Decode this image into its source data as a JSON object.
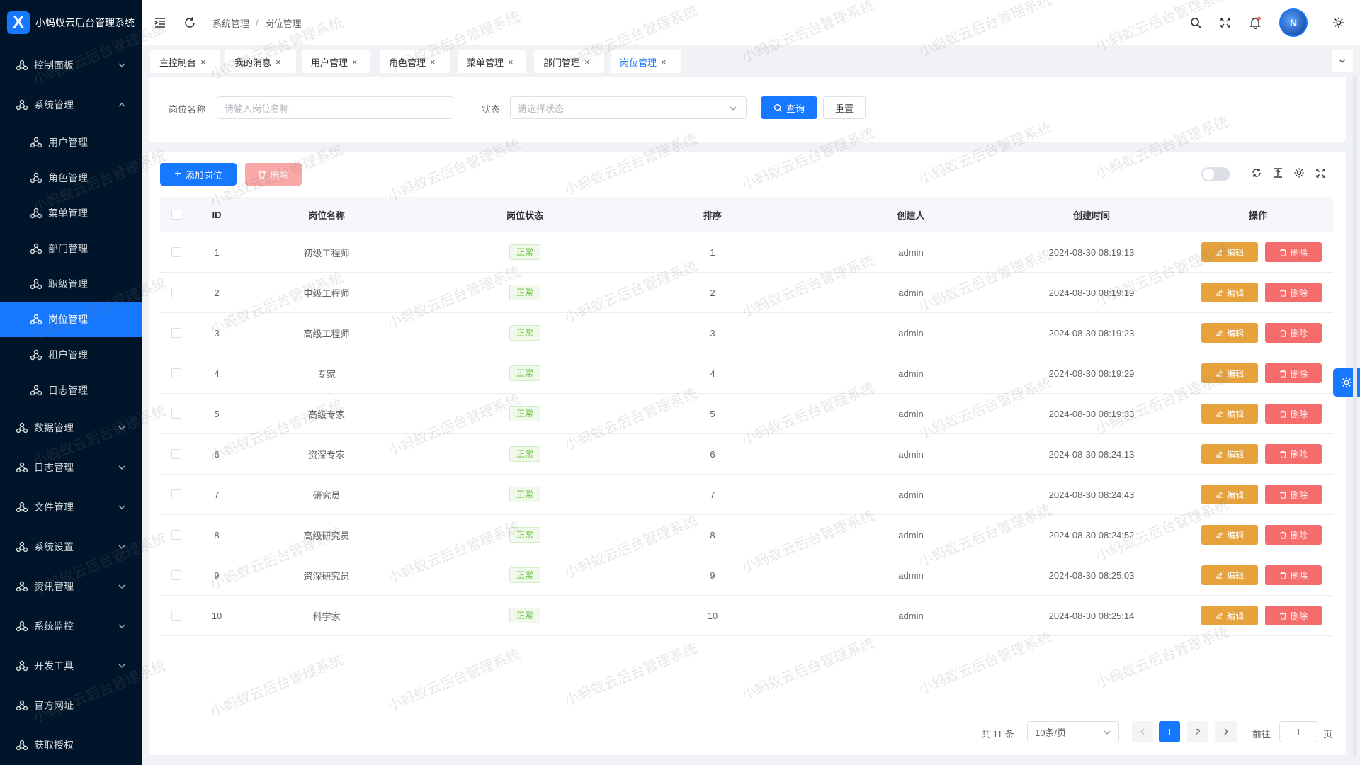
{
  "app": {
    "title": "小蚂蚁云后台管理系统",
    "logo_letter": "X",
    "watermark": "小蚂蚁云后台管理系统"
  },
  "colors": {
    "primary": "#1677ff",
    "sidebar_bg": "#001529",
    "warning": "#e6a23c",
    "danger": "#f56c6c",
    "success": "#67c23a"
  },
  "sidebar": {
    "menu": [
      {
        "label": "控制面板",
        "icon": "dashboard-icon",
        "expanded": false
      },
      {
        "label": "系统管理",
        "icon": "settings-group-icon",
        "expanded": true
      },
      {
        "label": "数据管理",
        "icon": "data-icon",
        "expanded": false
      },
      {
        "label": "日志管理",
        "icon": "log-icon",
        "expanded": false
      },
      {
        "label": "文件管理",
        "icon": "file-icon",
        "expanded": false
      },
      {
        "label": "系统设置",
        "icon": "system-settings-icon",
        "expanded": false
      },
      {
        "label": "资讯管理",
        "icon": "news-icon",
        "expanded": false
      },
      {
        "label": "系统监控",
        "icon": "monitor-icon",
        "expanded": false
      },
      {
        "label": "开发工具",
        "icon": "dev-tools-icon",
        "expanded": false
      },
      {
        "label": "官方网址",
        "icon": "website-icon",
        "expanded": false
      },
      {
        "label": "获取授权",
        "icon": "license-icon",
        "expanded": false
      }
    ],
    "submenu": [
      {
        "label": "用户管理",
        "active": false
      },
      {
        "label": "角色管理",
        "active": false
      },
      {
        "label": "菜单管理",
        "active": false
      },
      {
        "label": "部门管理",
        "active": false
      },
      {
        "label": "职级管理",
        "active": false
      },
      {
        "label": "岗位管理",
        "active": true
      },
      {
        "label": "租户管理",
        "active": false
      },
      {
        "label": "日志管理",
        "active": false
      }
    ]
  },
  "header": {
    "breadcrumb": [
      "系统管理",
      "岗位管理"
    ],
    "icons": [
      "menu-fold-icon",
      "refresh-icon",
      "search-icon",
      "fullscreen-icon",
      "bell-icon",
      "avatar",
      "gear-icon"
    ]
  },
  "tabs": [
    {
      "label": "主控制台",
      "active": false
    },
    {
      "label": "我的消息",
      "active": false
    },
    {
      "label": "用户管理",
      "active": false
    },
    {
      "label": "角色管理",
      "active": false
    },
    {
      "label": "菜单管理",
      "active": false
    },
    {
      "label": "部门管理",
      "active": false
    },
    {
      "label": "岗位管理",
      "active": true
    }
  ],
  "search": {
    "name_label": "岗位名称",
    "name_placeholder": "请输入岗位名称",
    "status_label": "状态",
    "status_placeholder": "请选择状态",
    "query_label": "查询",
    "reset_label": "重置"
  },
  "toolbar": {
    "add_label": "添加岗位",
    "delete_label": "删除"
  },
  "table": {
    "columns": [
      "ID",
      "岗位名称",
      "岗位状态",
      "排序",
      "创建人",
      "创建时间",
      "操作"
    ],
    "edit_label": "编辑",
    "delete_label": "删除",
    "rows": [
      {
        "id": "1",
        "name": "初级工程师",
        "status": "正常",
        "sort": "1",
        "creator": "admin",
        "created": "2024-08-30 08:19:13"
      },
      {
        "id": "2",
        "name": "中级工程师",
        "status": "正常",
        "sort": "2",
        "creator": "admin",
        "created": "2024-08-30 08:19:19"
      },
      {
        "id": "3",
        "name": "高级工程师",
        "status": "正常",
        "sort": "3",
        "creator": "admin",
        "created": "2024-08-30 08:19:23"
      },
      {
        "id": "4",
        "name": "专家",
        "status": "正常",
        "sort": "4",
        "creator": "admin",
        "created": "2024-08-30 08:19:29"
      },
      {
        "id": "5",
        "name": "高级专家",
        "status": "正常",
        "sort": "5",
        "creator": "admin",
        "created": "2024-08-30 08:19:33"
      },
      {
        "id": "6",
        "name": "资深专家",
        "status": "正常",
        "sort": "6",
        "creator": "admin",
        "created": "2024-08-30 08:24:13"
      },
      {
        "id": "7",
        "name": "研究员",
        "status": "正常",
        "sort": "7",
        "creator": "admin",
        "created": "2024-08-30 08:24:43"
      },
      {
        "id": "8",
        "name": "高级研究员",
        "status": "正常",
        "sort": "8",
        "creator": "admin",
        "created": "2024-08-30 08:24:52"
      },
      {
        "id": "9",
        "name": "资深研究员",
        "status": "正常",
        "sort": "9",
        "creator": "admin",
        "created": "2024-08-30 08:25:03"
      },
      {
        "id": "10",
        "name": "科学家",
        "status": "正常",
        "sort": "10",
        "creator": "admin",
        "created": "2024-08-30 08:25:14"
      }
    ]
  },
  "pagination": {
    "total_text": "共 11 条",
    "page_size": "10条/页",
    "pages": [
      "1",
      "2"
    ],
    "current_page": "1",
    "goto_label": "前往",
    "goto_value": "1",
    "page_suffix": "页"
  }
}
